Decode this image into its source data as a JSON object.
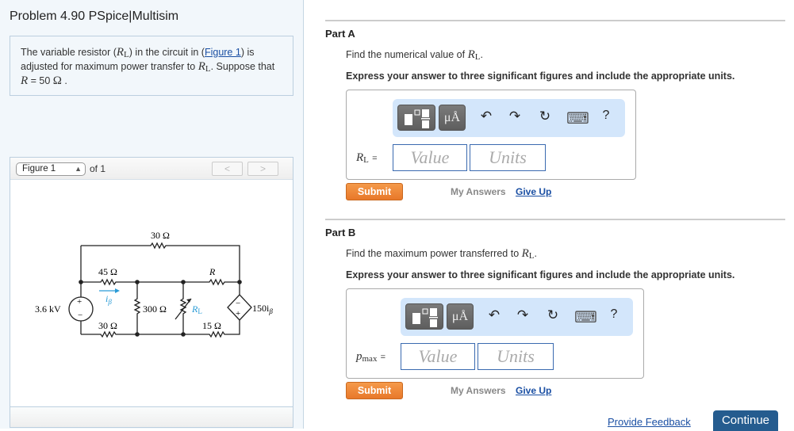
{
  "problem": {
    "title": "Problem 4.90 PSpice|Multisim",
    "text_1": "The variable resistor (",
    "var_R": "R",
    "sub_L": "L",
    "text_2": ") in the circuit in (",
    "figure_link": "Figure 1",
    "text_3": ") is adjusted for maximum power transfer to ",
    "text_4": ". Suppose that ",
    "text_5": " = 50 ",
    "ohm": "Ω",
    "text_6": " ."
  },
  "figure": {
    "selected": "Figure 1",
    "of_label": "of 1",
    "prev_icon": "<",
    "next_icon": ">",
    "circuit": {
      "r_top": "30 Ω",
      "r_45": "45 Ω",
      "r_30_bottom": "30 Ω",
      "r_300": "300 Ω",
      "r_R": "R",
      "r_L": "R",
      "r_L_sub": "L",
      "r_15": "15 Ω",
      "source": "3.6 kV",
      "current": "i",
      "current_sub": "β",
      "dep_source": "150i",
      "dep_source_sub": "β",
      "plus": "+",
      "minus": "−",
      "accent_color": "#2a9bd6"
    }
  },
  "parts": [
    {
      "title": "Part A",
      "question": "Find the numerical value of ",
      "question_var": "R",
      "question_sub": "L",
      "instruction": "Express your answer to three significant figures and include the appropriate units.",
      "answer_label": "R",
      "answer_sub": "L",
      "value_placeholder": "Value",
      "units_placeholder": "Units",
      "submit": "Submit",
      "my_answers": "My Answers",
      "give_up": "Give Up"
    },
    {
      "title": "Part B",
      "question": "Find the maximum power transferred to ",
      "question_var": "R",
      "question_sub": "L",
      "instruction": "Express your answer to three significant figures and include the appropriate units.",
      "answer_label": "p",
      "answer_sub": "max",
      "value_placeholder": "Value",
      "units_placeholder": "Units",
      "submit": "Submit",
      "my_answers": "My Answers",
      "give_up": "Give Up"
    }
  ],
  "toolbar": {
    "units_btn": "μÅ",
    "undo_icon": "↶",
    "redo_icon": "↷",
    "reset_icon": "↻",
    "keyboard_icon": "⌨",
    "help_icon": "?"
  },
  "footer": {
    "feedback": "Provide Feedback",
    "continue": "Continue"
  },
  "colors": {
    "submit": "#e8782a",
    "link": "#1a4fa3",
    "continue": "#255c8f",
    "toolbar": "#d3e6fb"
  }
}
